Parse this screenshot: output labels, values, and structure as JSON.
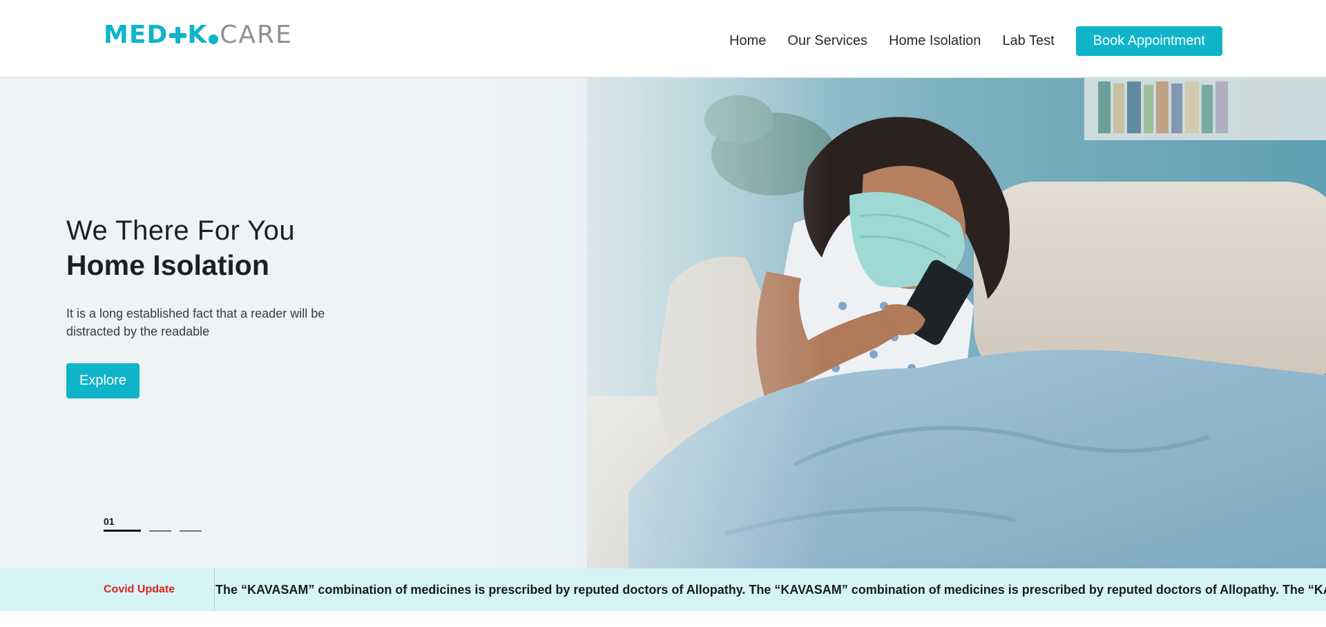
{
  "logo": {
    "part1": "MED",
    "part2": "K",
    "part3": "CARE"
  },
  "nav": {
    "items": [
      {
        "label": "Home"
      },
      {
        "label": "Our Services"
      },
      {
        "label": "Home Isolation"
      },
      {
        "label": "Lab Test"
      }
    ],
    "cta": "Book Appointment"
  },
  "hero": {
    "line1": "We There For You",
    "line2": "Home Isolation",
    "description": "It is a long established fact that a reader will be distracted by the readable",
    "button": "Explore",
    "slide_number": "01",
    "slides_total": 3,
    "active_slide": 1
  },
  "ticker": {
    "label": "Covid Update",
    "text": "The “KAVASAM” combination of medicines is prescribed by reputed doctors of Allopathy. The “KAVASAM” combination of medicines is prescribed by reputed doctors of Allopathy. The “KAVASAM” combination of medicines is prescribed by reputed doctors of Allopathy."
  },
  "colors": {
    "accent": "#0fb4c8",
    "ticker_bg": "#d6f4f6",
    "alert": "#e0201b"
  }
}
